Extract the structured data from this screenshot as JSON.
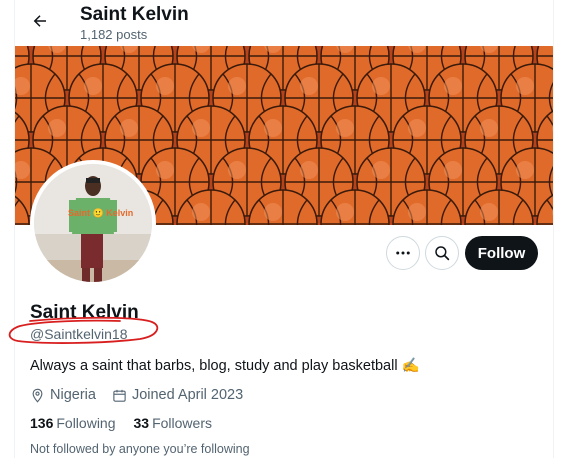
{
  "header": {
    "name": "Saint Kelvin",
    "posts": "1,182 posts"
  },
  "banner": {
    "theme": "basketballs"
  },
  "avatar": {
    "overlay_text": "Saint 🙂 Kelvin"
  },
  "actions": {
    "follow_label": "Follow"
  },
  "profile": {
    "name": "Saint Kelvin",
    "handle": "@Saintkelvin18",
    "bio": "Always a saint that barbs, blog, study and play basketball ✍️",
    "location": "Nigeria",
    "joined": "Joined April 2023",
    "following_count": "136",
    "following_label": "Following",
    "followers_count": "33",
    "followers_label": "Followers",
    "not_followed_note": "Not followed by anyone you’re following"
  },
  "colors": {
    "text": "#0f1419",
    "muted": "#536471",
    "follow_bg": "#0f1419",
    "ball": "#e06a2a",
    "annotation": "#d81e1e"
  }
}
